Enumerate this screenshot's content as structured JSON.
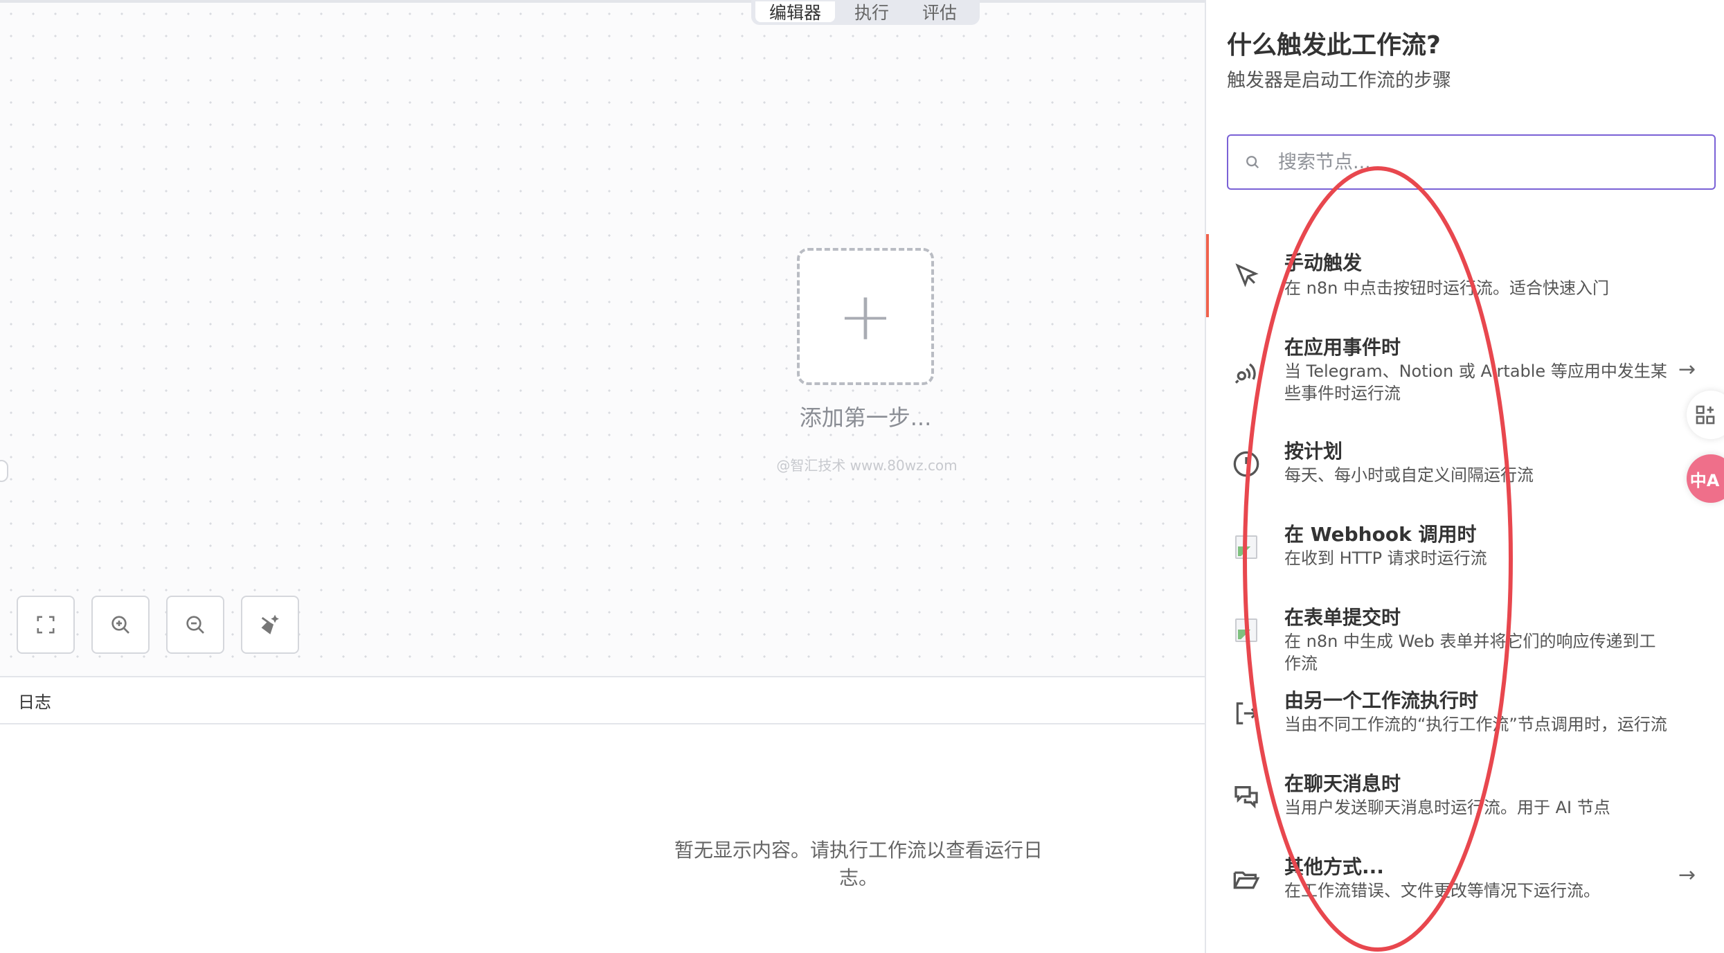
{
  "tabs": [
    {
      "label": "编辑器",
      "active": true
    },
    {
      "label": "执行",
      "active": false
    },
    {
      "label": "评估",
      "active": false
    }
  ],
  "canvas": {
    "add_label": "添加第一步...",
    "watermark": "@智汇技术 www.80wz.com",
    "controls": [
      {
        "name": "fit-view-button",
        "icon": "fullscreen-icon"
      },
      {
        "name": "zoom-in-button",
        "icon": "zoom-in-icon"
      },
      {
        "name": "zoom-out-button",
        "icon": "zoom-out-icon"
      },
      {
        "name": "tidy-up-button",
        "icon": "broom-icon"
      }
    ]
  },
  "logs": {
    "title": "日志",
    "empty_line1": "暂无显示内容。请执行工作流以查看运行日",
    "empty_line2": "志。"
  },
  "panel": {
    "title": "什么触发此工作流?",
    "subtitle": "触发器是启动工作流的步骤",
    "search_placeholder": "搜索节点...",
    "items": [
      {
        "icon": "cursor-icon",
        "title": "手动触发",
        "desc": "在 n8n 中点击按钮时运行流。适合快速入门",
        "arrow": false
      },
      {
        "icon": "app-event-icon",
        "title": "在应用事件时",
        "desc": "当 Telegram、Notion 或 Airtable 等应用中发生某些事件时运行流",
        "arrow": true
      },
      {
        "icon": "clock-icon",
        "title": "按计划",
        "desc": "每天、每小时或自定义间隔运行流",
        "arrow": false
      },
      {
        "icon": "image-placeholder-icon",
        "title": "在 Webhook 调用时",
        "desc": "在收到 HTTP 请求时运行流",
        "arrow": false
      },
      {
        "icon": "image-placeholder-icon",
        "title": "在表单提交时",
        "desc": "在 n8n 中生成 Web 表单并将它们的响应传递到工作流",
        "arrow": false
      },
      {
        "icon": "sign-in-icon",
        "title": "由另一个工作流执行时",
        "desc": "当由不同工作流的“执行工作流”节点调用时，运行流",
        "arrow": false
      },
      {
        "icon": "chat-icon",
        "title": "在聊天消息时",
        "desc": "当用户发送聊天消息时运行流。用于 AI 节点",
        "arrow": false
      },
      {
        "icon": "folder-open-icon",
        "title": "其他方式...",
        "desc": "在工作流错误、文件更改等情况下运行流。",
        "arrow": true
      }
    ],
    "arrow_glyph": "→"
  },
  "side_floats": {
    "translate_label": "中A"
  },
  "colors": {
    "accent": "#7a61d6",
    "active_marker": "#f0624c",
    "annotation": "#e8474e"
  }
}
